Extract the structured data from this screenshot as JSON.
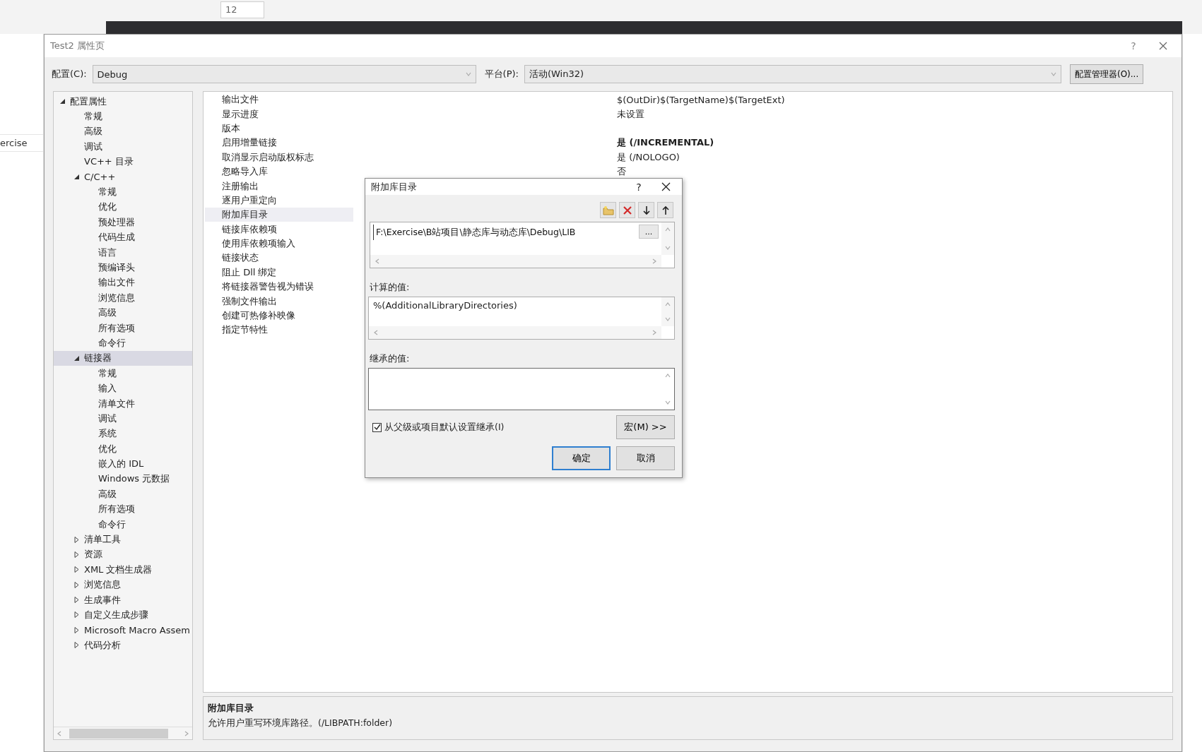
{
  "background": {
    "font_size": "12",
    "breadcrumb": "ercise"
  },
  "window": {
    "title": "Test2 属性页",
    "help": "?"
  },
  "config": {
    "label": "配置(C):",
    "value": "Debug"
  },
  "platform": {
    "label": "平台(P):",
    "value": "活动(Win32)"
  },
  "manager_button": "配置管理器(O)...",
  "tree": [
    {
      "label": "配置属性",
      "expanded": true,
      "selected": false,
      "children": [
        {
          "label": "常规",
          "selected": false
        },
        {
          "label": "高级",
          "selected": false
        },
        {
          "label": "调试",
          "selected": false
        },
        {
          "label": "VC++ 目录",
          "selected": false
        },
        {
          "label": "C/C++",
          "expanded": true,
          "selected": false,
          "children": [
            {
              "label": "常规",
              "selected": false
            },
            {
              "label": "优化",
              "selected": false
            },
            {
              "label": "预处理器",
              "selected": false
            },
            {
              "label": "代码生成",
              "selected": false
            },
            {
              "label": "语言",
              "selected": false
            },
            {
              "label": "预编译头",
              "selected": false
            },
            {
              "label": "输出文件",
              "selected": false
            },
            {
              "label": "浏览信息",
              "selected": false
            },
            {
              "label": "高级",
              "selected": false
            },
            {
              "label": "所有选项",
              "selected": false
            },
            {
              "label": "命令行",
              "selected": false
            }
          ]
        },
        {
          "label": "链接器",
          "expanded": true,
          "selected": true,
          "children": [
            {
              "label": "常规",
              "selected": false
            },
            {
              "label": "输入",
              "selected": false
            },
            {
              "label": "清单文件",
              "selected": false
            },
            {
              "label": "调试",
              "selected": false
            },
            {
              "label": "系统",
              "selected": false
            },
            {
              "label": "优化",
              "selected": false
            },
            {
              "label": "嵌入的 IDL",
              "selected": false
            },
            {
              "label": "Windows 元数据",
              "selected": false
            },
            {
              "label": "高级",
              "selected": false
            },
            {
              "label": "所有选项",
              "selected": false
            },
            {
              "label": "命令行",
              "selected": false
            }
          ]
        },
        {
          "label": "清单工具",
          "expanded": false,
          "selected": false
        },
        {
          "label": "资源",
          "expanded": false,
          "selected": false
        },
        {
          "label": "XML 文档生成器",
          "expanded": false,
          "selected": false
        },
        {
          "label": "浏览信息",
          "expanded": false,
          "selected": false
        },
        {
          "label": "生成事件",
          "expanded": false,
          "selected": false
        },
        {
          "label": "自定义生成步骤",
          "expanded": false,
          "selected": false
        },
        {
          "label": "Microsoft Macro Assem",
          "expanded": false,
          "selected": false
        },
        {
          "label": "代码分析",
          "expanded": false,
          "selected": false
        }
      ]
    }
  ],
  "properties": [
    {
      "name": "输出文件",
      "value": "$(OutDir)$(TargetName)$(TargetExt)",
      "selected": false
    },
    {
      "name": "显示进度",
      "value": "未设置",
      "selected": false
    },
    {
      "name": "版本",
      "selected": false
    },
    {
      "name": "启用增量链接",
      "value": "是 (/INCREMENTAL)",
      "bold": true,
      "selected": false
    },
    {
      "name": "取消显示启动版权标志",
      "value": "是 (/NOLOGO)",
      "selected": false
    },
    {
      "name": "忽略导入库",
      "value": "否",
      "selected": false
    },
    {
      "name": "注册输出",
      "selected": false
    },
    {
      "name": "逐用户重定向",
      "selected": false
    },
    {
      "name": "附加库目录",
      "selected": true
    },
    {
      "name": "链接库依赖项",
      "selected": false
    },
    {
      "name": "使用库依赖项输入",
      "selected": false
    },
    {
      "name": "链接状态",
      "selected": false
    },
    {
      "name": "阻止 Dll 绑定",
      "selected": false
    },
    {
      "name": "将链接器警告视为错误",
      "selected": false
    },
    {
      "name": "强制文件输出",
      "selected": false
    },
    {
      "name": "创建可热修补映像",
      "selected": false
    },
    {
      "name": "指定节特性",
      "selected": false
    }
  ],
  "description": {
    "title": "附加库目录",
    "text": "允许用户重写环境库路径。(/LIBPATH:folder)"
  },
  "dialog": {
    "title": "附加库目录",
    "help": "?",
    "entry": "F:\\Exercise\\B站项目\\静态库与动态库\\Debug\\LIB",
    "browse_button": "...",
    "computed_label": "计算的值:",
    "computed_value": "%(AdditionalLibraryDirectories)",
    "inherited_label": "继承的值:",
    "inherit": {
      "label": "从父级或项目默认设置继承(I)",
      "checked": true
    },
    "macro_button": "宏(M) >>",
    "buttons": [
      {
        "label": "确定",
        "kind": "default"
      },
      {
        "label": "取消",
        "kind": "normal"
      }
    ]
  }
}
